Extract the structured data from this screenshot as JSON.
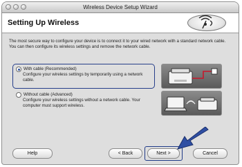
{
  "window": {
    "title": "Wireless Device Setup Wizard"
  },
  "header": {
    "title": "Setting Up Wireless"
  },
  "intro": "The most secure way to configure your device is to connect it to your wired network with a standard network cable. You can then configure its wireless settings and remove the network cable.",
  "options": [
    {
      "label": "With cable (Recommended)",
      "description": "Configure your wireless settings by temporarily using a network cable.",
      "selected": true
    },
    {
      "label": "Without cable (Advanced)",
      "description": "Configure your wireless settings without a network cable. Your computer must support wireless.",
      "selected": false
    }
  ],
  "buttons": {
    "help": "Help",
    "back": "< Back",
    "next": "Next >",
    "cancel": "Cancel"
  },
  "icons": {
    "wireless_logo": "wireless-signal-icon",
    "pointer_arrow": "arrow-icon"
  },
  "colors": {
    "accent": "#263e8a",
    "arrow": "#2f4fa3"
  }
}
